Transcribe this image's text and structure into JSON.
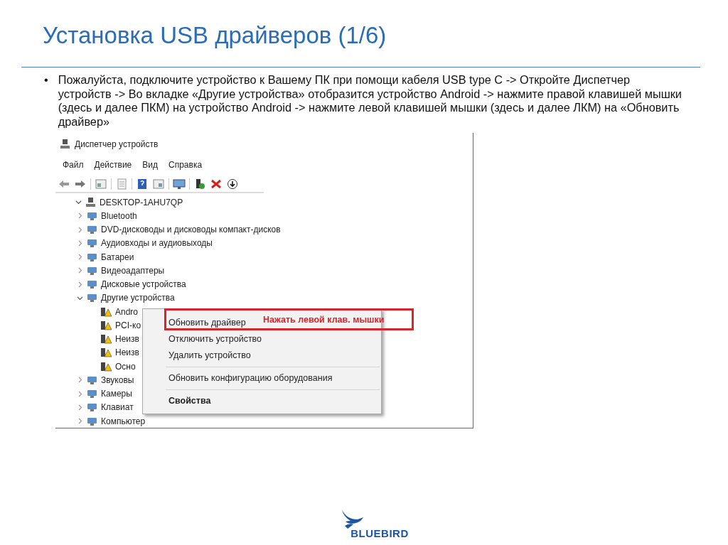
{
  "slide": {
    "title": "Установка USB драйверов (1/6)",
    "bullet_marker": "•",
    "bullets": [
      "Пожалуйста, подключите устройство к Вашему ПК при помощи кабеля USB type C -> Откройте Диспетчер устройств -> Во вкладке «Другие устройства» отобразится устройство Android -> нажмите правой клавишей мышки (здесь и далее ПКМ) на устройство Android -> нажмите левой клавишей мышки (здесь и далее ЛКМ) на «Обновить драйвер»"
    ],
    "logo": "BLUEBIRD"
  },
  "window": {
    "title": "Диспетчер устройств",
    "menu": [
      "Файл",
      "Действие",
      "Вид",
      "Справка"
    ],
    "tree": {
      "label": "DESKTOP-1AHU7QP",
      "expanded": true,
      "children": [
        {
          "label": "Bluetooth",
          "expanded": false
        },
        {
          "label": "DVD-дисководы и дисководы компакт-дисков",
          "expanded": false
        },
        {
          "label": "Аудиовходы и аудиовыходы",
          "expanded": false
        },
        {
          "label": "Батареи",
          "expanded": false
        },
        {
          "label": "Видеоадаптеры",
          "expanded": false
        },
        {
          "label": "Дисковые устройства",
          "expanded": false
        },
        {
          "label": "Другие устройства",
          "expanded": true,
          "children": [
            {
              "label": "Andro",
              "warning": true
            },
            {
              "label": "PCI-ко",
              "warning": true
            },
            {
              "label": "Неизв",
              "warning": true
            },
            {
              "label": "Неизв",
              "warning": true
            },
            {
              "label": "Осно",
              "warning": true
            }
          ]
        },
        {
          "label": "Звуковы",
          "expanded": false
        },
        {
          "label": "Камеры",
          "expanded": false
        },
        {
          "label": "Клавиат",
          "expanded": false
        },
        {
          "label": "Компьютер",
          "expanded": false
        }
      ]
    },
    "context_menu": {
      "groups": [
        [
          {
            "label": "Обновить драйвер",
            "default": false
          },
          {
            "label": "Отключить устройство",
            "default": false
          },
          {
            "label": "Удалить устройство",
            "default": false
          }
        ],
        [
          {
            "label": "Обновить конфигурацию оборудования",
            "default": false
          }
        ],
        [
          {
            "label": "Свойства",
            "default": true
          }
        ]
      ]
    },
    "annotation": "Нажать левой клав. мышки"
  }
}
